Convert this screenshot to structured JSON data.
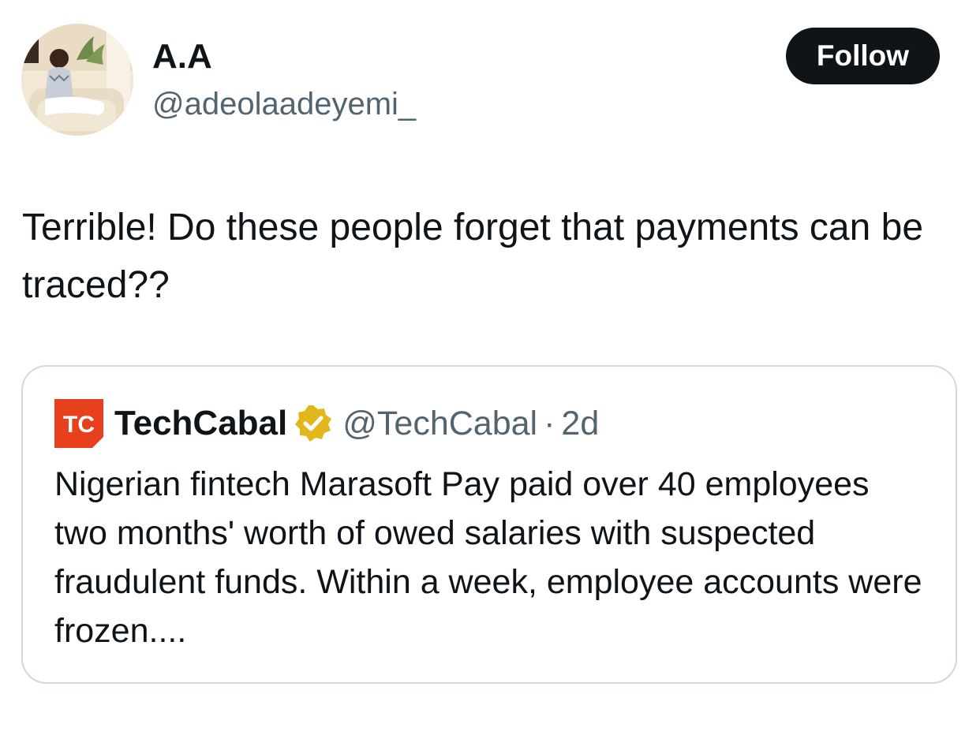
{
  "author": {
    "name": "A.A",
    "handle": "@adeolaadeyemi_",
    "avatar_icon": "profile-photo"
  },
  "follow_label": "Follow",
  "tweet": {
    "text": "Terrible! Do these people forget that payments can be traced??"
  },
  "quoted": {
    "logo_icon": "techcabal-logo",
    "logo_text": "TC",
    "name": "TechCabal",
    "verified_icon": "gold-verified-badge",
    "handle": "@TechCabal",
    "separator": "·",
    "time": "2d",
    "text": "Nigerian fintech Marasoft Pay paid over 40 employees two months' worth of owed salaries with suspected fraudulent funds. Within a week, employee accounts were frozen...."
  },
  "colors": {
    "text_primary": "#0f1419",
    "text_secondary": "#536471",
    "border": "#cfd9de",
    "follow_bg": "#0f1419",
    "techcabal_red": "#e8401c",
    "verified_gold": "#e2b719"
  }
}
